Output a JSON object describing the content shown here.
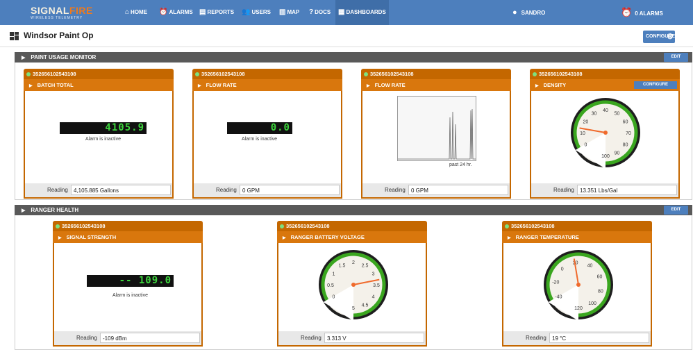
{
  "brand": {
    "name_part1": "SIGNAL",
    "name_part2": "FIRE",
    "tagline": "WIRELESS TELEMETRY"
  },
  "nav": {
    "items": [
      {
        "label": "HOME",
        "icon": "home-icon"
      },
      {
        "label": "ALARMS",
        "icon": "alarm-clock-icon"
      },
      {
        "label": "REPORTS",
        "icon": "report-icon"
      },
      {
        "label": "USERS",
        "icon": "users-icon"
      },
      {
        "label": "MAP",
        "icon": "map-icon"
      },
      {
        "label": "DOCS",
        "icon": "help-icon"
      },
      {
        "label": "DASHBOARDS",
        "icon": "dashboard-icon",
        "active": true
      }
    ],
    "user": "SANDRO",
    "alarm_count": "0 ALARMS"
  },
  "page": {
    "title": "Windsor Paint Op",
    "configure_label": "CONFIGURE"
  },
  "sections": [
    {
      "title": "PAINT USAGE MONITOR",
      "edit_label": "EDIT",
      "cards": [
        {
          "device": "352656102543108",
          "title": "BATCH TOTAL",
          "display": "4105.9",
          "alarm": "Alarm is inactive",
          "reading_label": "Reading",
          "reading": "4,105.885 Gallons"
        },
        {
          "device": "352656102543108",
          "title": "FLOW RATE",
          "display": "0.0",
          "alarm": "Alarm is inactive",
          "reading_label": "Reading",
          "reading": "0 GPM"
        },
        {
          "device": "352656102543108",
          "title": "FLOW RATE",
          "chart_caption": "past 24 hr.",
          "reading_label": "Reading",
          "reading": "0 GPM"
        },
        {
          "device": "352656102543108",
          "title": "DENSITY",
          "configure_label": "CONFIGURE",
          "gauge": {
            "min": 0,
            "max": 100,
            "value": 13.351,
            "ticks": [
              "0",
              "10",
              "20",
              "30",
              "40",
              "50",
              "60",
              "70",
              "80",
              "90",
              "100"
            ]
          },
          "reading_label": "Reading",
          "reading": "13.351 Lbs/Gal"
        }
      ]
    },
    {
      "title": "RANGER HEALTH",
      "edit_label": "EDIT",
      "cards": [
        {
          "device": "352656102543108",
          "title": "SIGNAL STRENGTH",
          "display": "-- 109.0",
          "alarm": "Alarm is inactive",
          "reading_label": "Reading",
          "reading": "-109 dBm"
        },
        {
          "device": "352656102543108",
          "title": "RANGER BATTERY VOLTAGE",
          "gauge": {
            "min": 0,
            "max": 5,
            "value": 3.313,
            "ticks": [
              "0",
              "0.5",
              "1",
              "1.5",
              "2",
              "2.5",
              "3",
              "3.5",
              "4",
              "4.5",
              "5"
            ]
          },
          "reading_label": "Reading",
          "reading": "3.313 V"
        },
        {
          "device": "352656102543108",
          "title": "RANGER TEMPERATURE",
          "gauge": {
            "min": -40,
            "max": 120,
            "value": 19,
            "ticks": [
              "-40",
              "-20",
              "0",
              "20",
              "40",
              "60",
              "80",
              "100",
              "120"
            ]
          },
          "reading_label": "Reading",
          "reading": "19 °C"
        }
      ]
    }
  ],
  "colors": {
    "nav_bg": "#4d7fbd",
    "card_header": "#c46700",
    "card_sub": "#d9770d",
    "lcd_green": "#3dd43d",
    "gauge_green": "#3aa61f",
    "needle": "#f06a2c"
  }
}
